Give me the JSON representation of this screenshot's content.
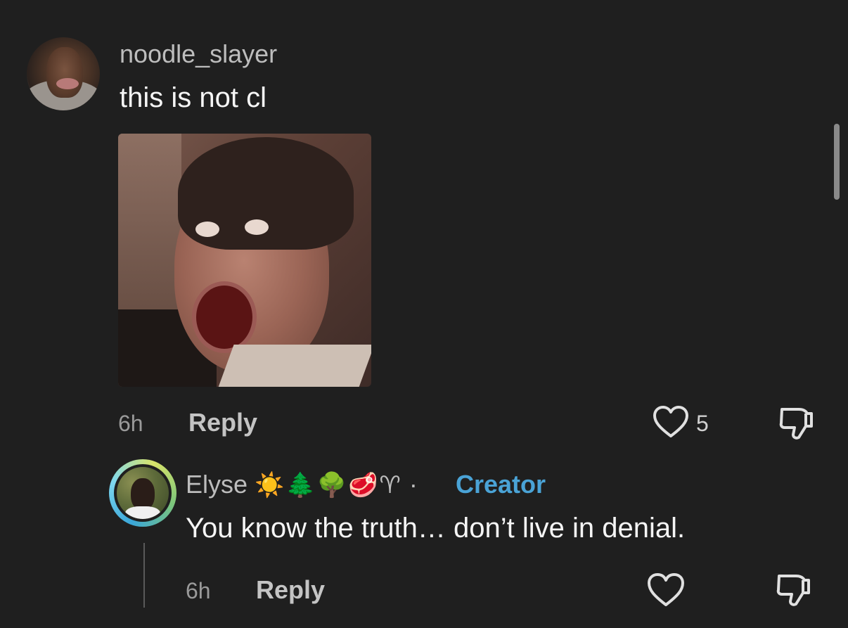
{
  "comment": {
    "username": "noodle_slayer",
    "text": "this is not cl",
    "time": "6h",
    "reply_label": "Reply",
    "like_count": "5"
  },
  "reply": {
    "username": "Elyse",
    "emojis": "☀️🌲🌳🥩♈",
    "separator": "·",
    "badge": "Creator",
    "text": "You know the truth… don’t live in denial.",
    "time": "6h",
    "reply_label": "Reply"
  },
  "colors": {
    "background": "#1f1f1f",
    "creator_badge": "#4aa3d6"
  },
  "icons": {
    "like": "heart-outline-icon",
    "dislike": "thumbs-down-outline-icon"
  }
}
